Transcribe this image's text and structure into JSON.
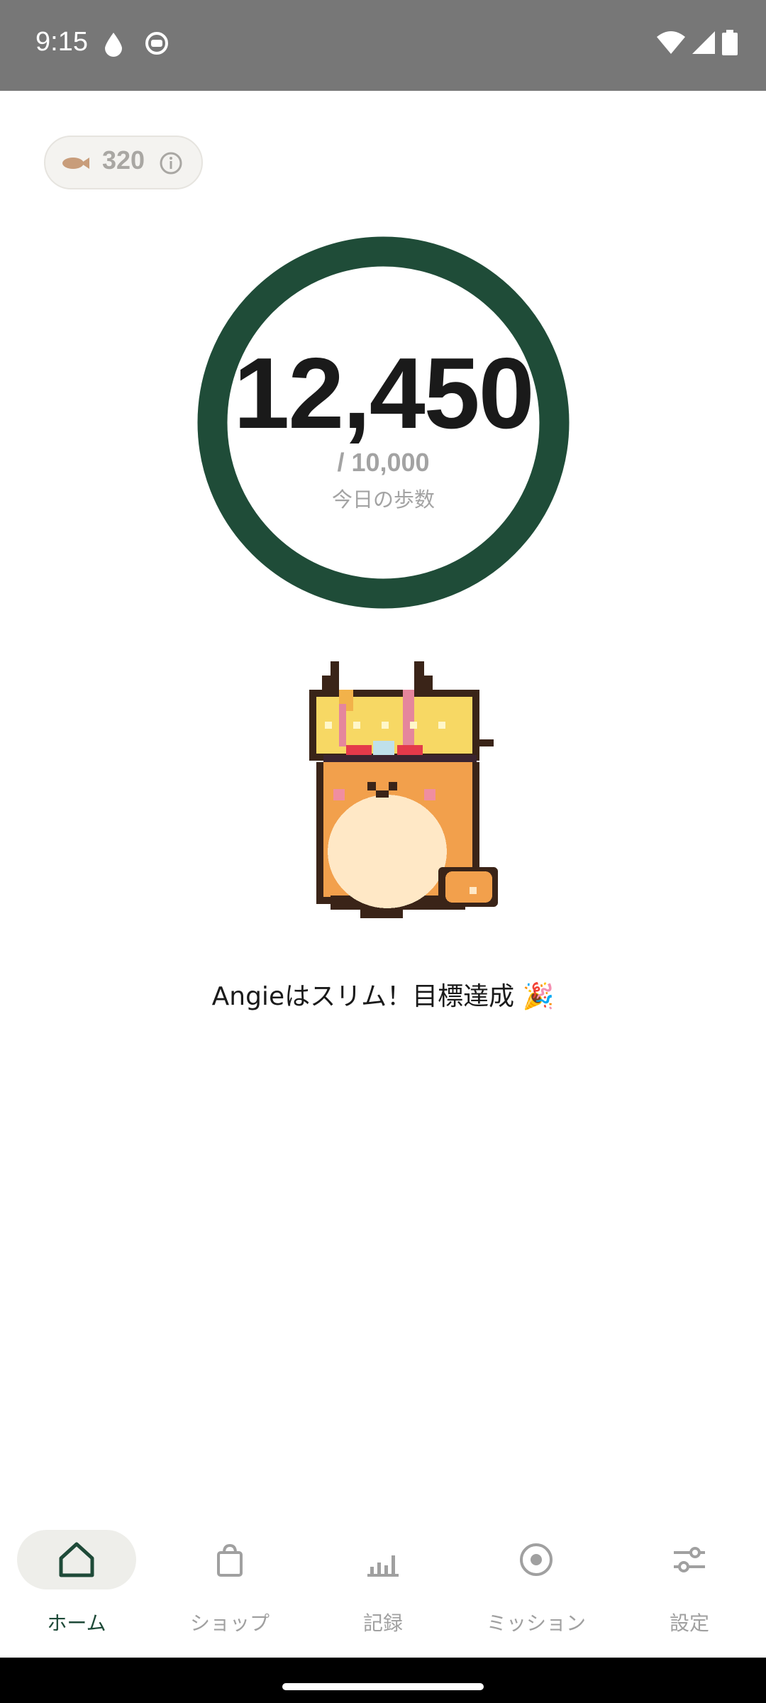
{
  "status_bar": {
    "time": "9:15"
  },
  "coins": {
    "value": "320"
  },
  "steps": {
    "value": "12,450",
    "goal": "/ 10,000",
    "label": "今日の歩数",
    "progress": 1.0
  },
  "cat": {
    "message": "Angieはスリム！目標達成 🎉"
  },
  "nav": {
    "items": [
      {
        "label": "ホーム",
        "icon": "home-icon",
        "active": true
      },
      {
        "label": "ショップ",
        "icon": "shopping-bag-icon",
        "active": false
      },
      {
        "label": "記録",
        "icon": "bar-chart-icon",
        "active": false
      },
      {
        "label": "ミッション",
        "icon": "target-icon",
        "active": false
      },
      {
        "label": "設定",
        "icon": "sliders-icon",
        "active": false
      }
    ]
  },
  "colors": {
    "ring": "#1f4c38",
    "accent": "#1e4a38",
    "status_bar": "#777777"
  }
}
